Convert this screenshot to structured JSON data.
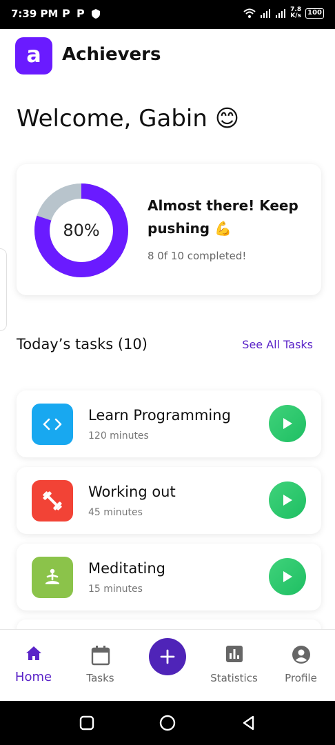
{
  "status_bar": {
    "time": "7:39 PM",
    "notif_icons": [
      "P",
      "P"
    ],
    "speed_value": "7.8",
    "speed_unit": "K/s",
    "battery": "100"
  },
  "header": {
    "logo_letter": "a",
    "app_name": "Achievers",
    "brand_color": "#6a1bff"
  },
  "welcome": {
    "text": "Welcome, Gabin 😊"
  },
  "progress": {
    "percent_label": "80%",
    "fraction": 0.8,
    "message": "Almost there! Keep pushing 💪",
    "completed_text": "8 0f 10 completed!",
    "ring_color": "#6a1bff",
    "track_color": "#b8c4cc"
  },
  "tasks_section": {
    "title": "Today’s tasks (10)",
    "see_all_label": "See All Tasks"
  },
  "tasks": [
    {
      "name": "Learn Programming",
      "duration": "120 minutes",
      "icon": "code-icon",
      "color": "#18a8f0"
    },
    {
      "name": "Working out",
      "duration": "45 minutes",
      "icon": "dumbbell-icon",
      "color": "#f24336"
    },
    {
      "name": "Meditating",
      "duration": "15 minutes",
      "icon": "meditation-icon",
      "color": "#8bc34a"
    }
  ],
  "bottom_nav": {
    "items": [
      {
        "label": "Home",
        "icon": "home-icon",
        "active": true
      },
      {
        "label": "Tasks",
        "icon": "calendar-icon",
        "active": false
      },
      {
        "label": "Statistics",
        "icon": "bar-chart-icon",
        "active": false
      },
      {
        "label": "Profile",
        "icon": "account-icon",
        "active": false
      }
    ],
    "fab_icon": "plus-icon",
    "accent_color": "#5a23c8"
  },
  "system_nav": {
    "buttons": [
      "recents-icon",
      "home-circle-icon",
      "back-icon"
    ]
  }
}
